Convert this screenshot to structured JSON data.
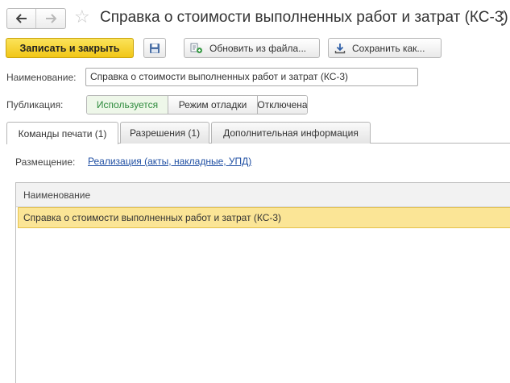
{
  "window": {
    "title": "Справка о стоимости выполненных работ и затрат (КС-3)",
    "back_icon": "arrow-left-icon",
    "forward_icon": "arrow-right-icon",
    "favorite_icon": "star-icon",
    "more_icon": "vertical-dots-icon"
  },
  "toolbar": {
    "save_close_label": "Записать и закрыть",
    "floppy_icon": "floppy-disk-icon",
    "update_label": "Обновить из файла...",
    "update_icon": "update-from-file-icon",
    "save_as_label": "Сохранить как...",
    "save_as_icon": "download-icon"
  },
  "form": {
    "name_label": "Наименование:",
    "name_value": "Справка о стоимости выполненных работ и затрат (КС-3)",
    "publication_label": "Публикация:",
    "publication_options": [
      "Используется",
      "Режим отладки",
      "Отключена"
    ],
    "publication_selected": "Используется"
  },
  "tabs": [
    {
      "label": "Команды печати (1)",
      "active": true
    },
    {
      "label": "Разрешения (1)",
      "active": false
    },
    {
      "label": "Дополнительная информация",
      "active": false
    }
  ],
  "placement": {
    "label": "Размещение:",
    "link": "Реализация (акты, накладные, УПД)"
  },
  "table": {
    "columns": [
      "Наименование"
    ],
    "rows": [
      [
        "Справка о стоимости выполненных работ и затрат (КС-3)"
      ]
    ]
  },
  "colors": {
    "primary_button": "#f1c617",
    "selected_row": "#fbe596",
    "active_segment_text": "#2e8b3d",
    "link": "#1f4fa3"
  }
}
